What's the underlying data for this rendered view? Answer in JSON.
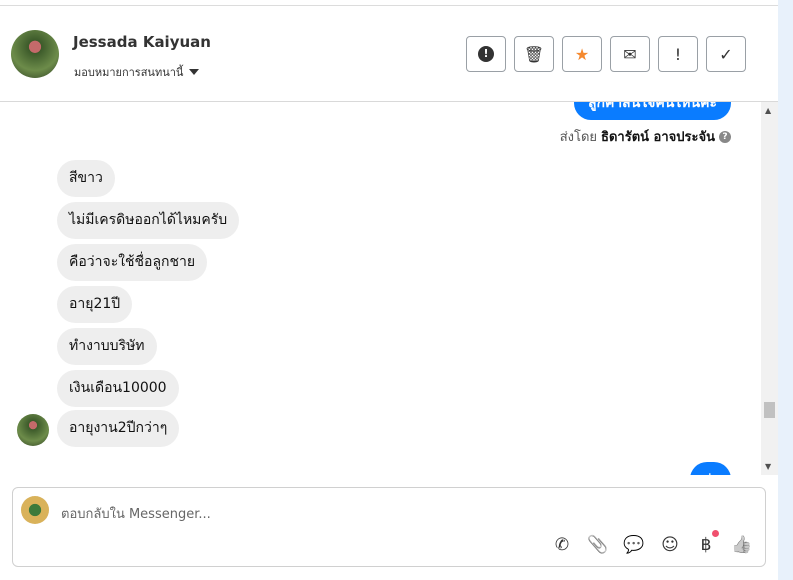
{
  "header": {
    "contact_name": "Jessada Kaiyuan",
    "assign_label": "มอบหมายการสนทนานี้",
    "actions": [
      {
        "name": "spam",
        "icon": "alert-octagon-icon",
        "glyph": "!"
      },
      {
        "name": "delete",
        "icon": "trash-icon",
        "glyph": "🗑"
      },
      {
        "name": "star",
        "icon": "star-icon",
        "glyph": "★",
        "color": "#f5892f"
      },
      {
        "name": "mark-unread",
        "icon": "envelope-icon",
        "glyph": "✉"
      },
      {
        "name": "follow-up",
        "icon": "exclamation-icon",
        "glyph": "!"
      },
      {
        "name": "done",
        "icon": "check-icon",
        "glyph": "✓"
      }
    ]
  },
  "messages": {
    "top_outgoing": "ลูกค้าสนใจคันไหนคะ",
    "sent_by_prefix": "ส่งโดย",
    "sent_by_name": "ธิดารัตน์ อาจประจัน",
    "help_glyph": "?",
    "incoming": [
      "สีขาว",
      "ไม่มีเครดิษออกได้ไหมครับ",
      "คือว่าจะใช้ชื่อลูกชาย",
      "อายุ21ปี",
      "ทำงาบบริษัท",
      "เงินเดือน10000",
      "อายุงาน2ปีกว่าๆ"
    ],
    "bottom_outgoing": "ค่ะ"
  },
  "composer": {
    "placeholder": "ตอบกลับใน Messenger...",
    "tools": [
      {
        "icon": "phone-plus-icon",
        "glyph": "✆"
      },
      {
        "icon": "paperclip-icon",
        "glyph": "📎"
      },
      {
        "icon": "chat-bubble-icon",
        "glyph": "💬"
      },
      {
        "icon": "smiley-icon",
        "glyph": "☺"
      },
      {
        "icon": "baht-icon",
        "glyph": "฿"
      },
      {
        "icon": "thumbs-up-icon",
        "glyph": "👍"
      }
    ]
  },
  "colors": {
    "accent": "#0a7cff",
    "star": "#f5892f",
    "badge": "#f0506e"
  }
}
